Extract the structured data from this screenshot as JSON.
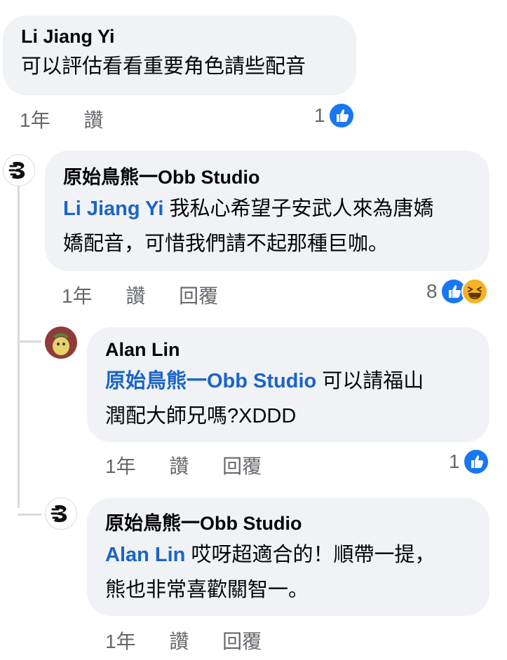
{
  "comments": [
    {
      "author": "Li Jiang Yi",
      "text": "可以評估看看重要角色請些配音",
      "time": "1年",
      "like": "讚",
      "reaction_count": "1"
    },
    {
      "author": "原始鳥熊一Obb Studio",
      "mention": "Li Jiang Yi",
      "text_line1": " 我私心希望子安武人來為唐嬌",
      "text_line2": "嬌配音，可惜我們請不起那種巨咖。",
      "time": "1年",
      "like": "讚",
      "reply": "回覆",
      "reaction_count": "8"
    },
    {
      "author": "Alan Lin",
      "mention": "原始鳥熊一Obb Studio",
      "text_line1": " 可以請福山",
      "text_line2": "潤配大師兄嗎?XDDD",
      "time": "1年",
      "like": "讚",
      "reply": "回覆",
      "reaction_count": "1"
    },
    {
      "author": "原始鳥熊一Obb Studio",
      "mention": "Alan Lin",
      "text_line1": " 哎呀超適合的！順帶一提，",
      "text_line2": "熊也非常喜歡關智一。",
      "time": "1年",
      "like": "讚",
      "reply": "回覆"
    }
  ],
  "colors": {
    "bubble": "#f0f2f5",
    "mention": "#1b64c8",
    "like": "#1877f2",
    "haha": "#f7b125",
    "meta": "#65676b"
  },
  "icons": {
    "like": "like-reaction-icon",
    "haha": "haha-reaction-icon",
    "page_logo": "obb-studio-logo-icon"
  }
}
